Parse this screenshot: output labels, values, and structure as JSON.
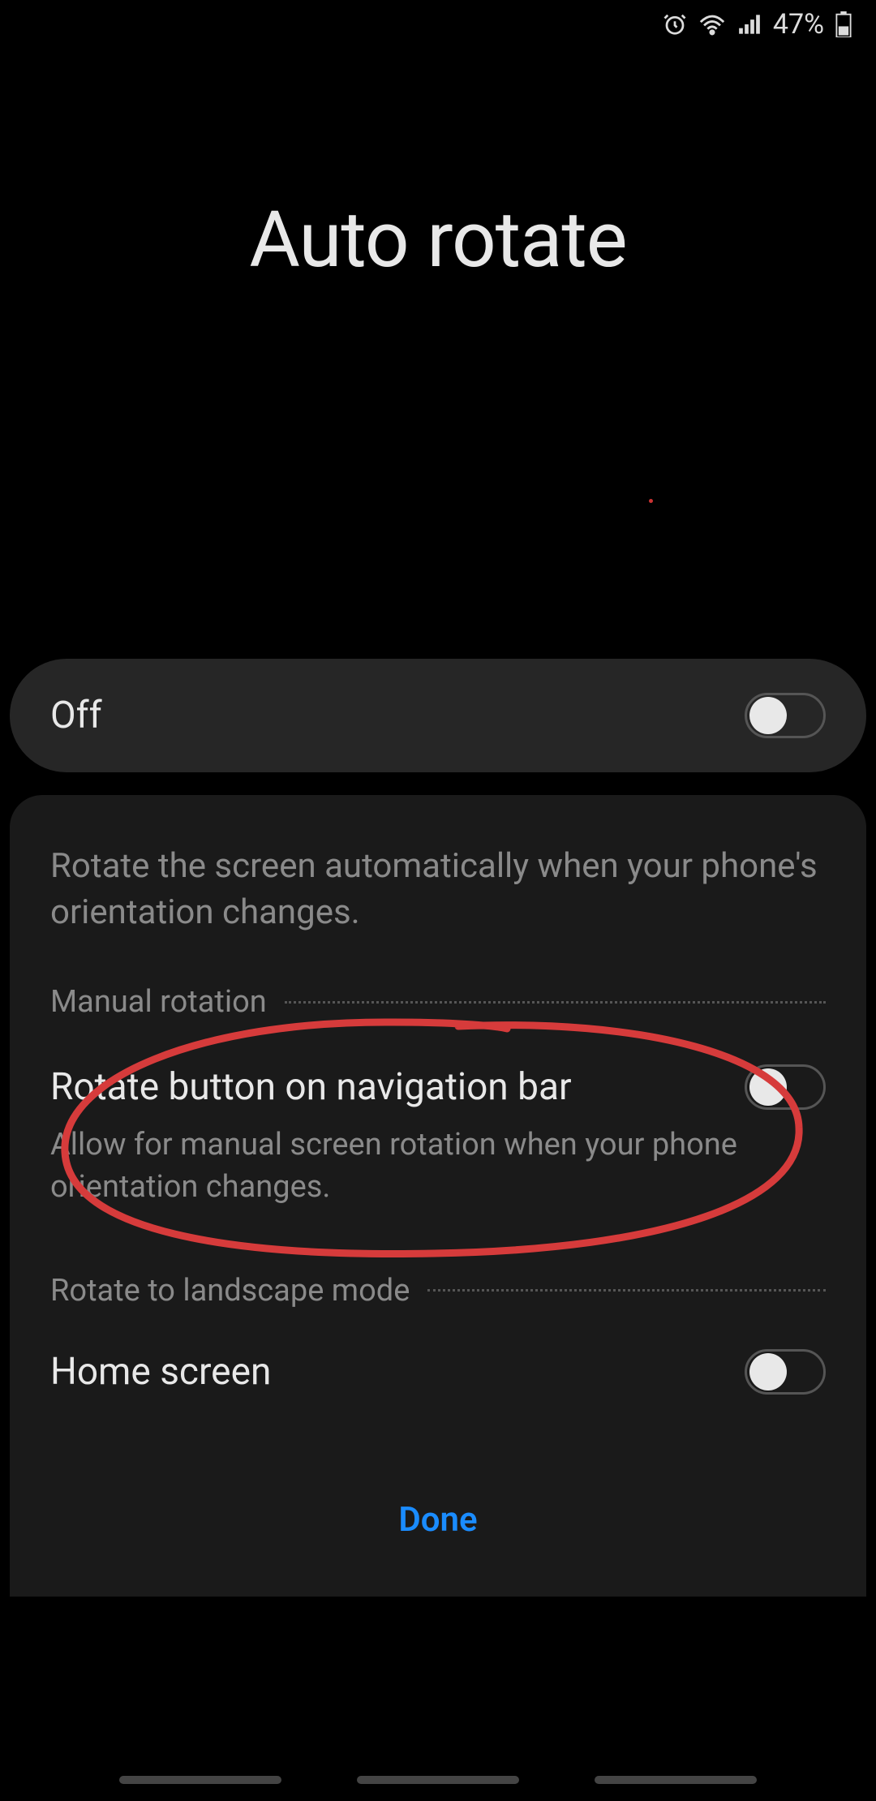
{
  "status": {
    "battery_percent": "47%"
  },
  "page": {
    "title": "Auto rotate"
  },
  "main_toggle": {
    "label": "Off",
    "state": "off"
  },
  "card": {
    "description": "Rotate the screen automatically when your phone's orientation changes.",
    "section_manual": "Manual rotation",
    "rotate_button": {
      "title": "Rotate button on navigation bar",
      "subtitle": "Allow for manual screen rotation when your phone orientation changes.",
      "state": "off"
    },
    "section_landscape": "Rotate to landscape mode",
    "home_screen": {
      "title": "Home screen",
      "state": "off"
    }
  },
  "actions": {
    "done": "Done"
  }
}
